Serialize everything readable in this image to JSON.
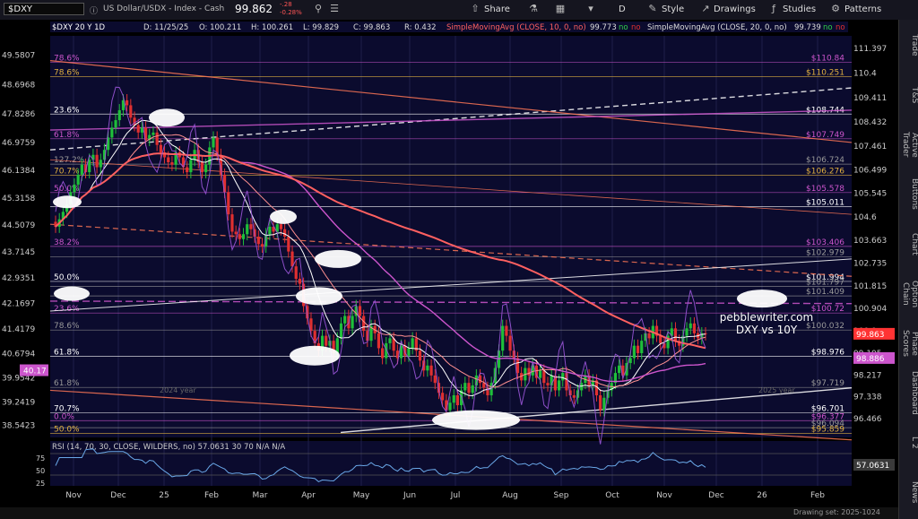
{
  "toolbar": {
    "symbol": "$DXY",
    "description": "US Dollar/USDX - Index - Cash",
    "last": "99.862",
    "change": "-.28",
    "change_pct": "-0.28%",
    "share": "Share",
    "interval": "D",
    "style": "Style",
    "drawings": "Drawings",
    "studies": "Studies",
    "patterns": "Patterns"
  },
  "side_tabs": [
    "Trade",
    "T&S",
    "Active Trader",
    "Buttons",
    "Chart",
    "Option Chain",
    "Phase Scores",
    "Dashboard",
    "L 2",
    "News"
  ],
  "status": {
    "drawing_set": "Drawing set: 2025-1024"
  },
  "chart_data": {
    "type": "candlestick",
    "header": {
      "symbol_line": "$DXY 20 Y 1D",
      "date": "D: 11/25/25",
      "open": "O: 100.211",
      "high": "H: 100.261",
      "low": "L: 99.829",
      "close": "C: 99.863",
      "range": "R: 0.432",
      "sma10": "SimpleMovingAvg (CLOSE, 10, 0, no)",
      "sma10_val": "99.773",
      "sma20": "SimpleMovingAvg (CLOSE, 20, 0, no)",
      "sma20_val": "99.739",
      "no": "no"
    },
    "watermark": "pebblewriter.com",
    "subtitle": "DXY vs 10Y",
    "ylim": [
      95.7,
      111.9
    ],
    "right_ticks": [
      "111.397",
      "110.4",
      "109.411",
      "108.432",
      "107.461",
      "106.499",
      "105.545",
      "104.6",
      "103.663",
      "102.735",
      "101.815",
      "100.904",
      "100.0",
      "99.105",
      "98.217",
      "97.338",
      "96.466"
    ],
    "left_ticks": [
      "49.5807",
      "48.6968",
      "47.8286",
      "46.9759",
      "46.1384",
      "45.3158",
      "44.5079",
      "43.7145",
      "42.9351",
      "42.1697",
      "41.4179",
      "40.6794",
      "39.9542",
      "39.2419",
      "38.5423"
    ],
    "left_ylim": [
      38.18,
      50.15
    ],
    "x_ticks": [
      "Nov",
      "Dec",
      "25",
      "Feb",
      "Mar",
      "Apr",
      "May",
      "Jun",
      "Jul",
      "Aug",
      "Sep",
      "Oct",
      "Nov",
      "Dec",
      "26",
      "Feb"
    ],
    "fib_labels_right": [
      {
        "v": 110.84,
        "t": "$110.84",
        "c": "#cc55cc"
      },
      {
        "v": 110.251,
        "t": "$110.251",
        "c": "#e0b040"
      },
      {
        "v": 108.744,
        "t": "$108.744",
        "c": "#ffffff"
      },
      {
        "v": 107.749,
        "t": "$107.749",
        "c": "#cc55cc"
      },
      {
        "v": 106.724,
        "t": "$106.724",
        "c": "#999999"
      },
      {
        "v": 106.276,
        "t": "$106.276",
        "c": "#e0b040"
      },
      {
        "v": 105.578,
        "t": "$105.578",
        "c": "#cc55cc"
      },
      {
        "v": 105.011,
        "t": "$105.011",
        "c": "#ffffff"
      },
      {
        "v": 103.406,
        "t": "$103.406",
        "c": "#cc55cc"
      },
      {
        "v": 102.979,
        "t": "$102.979",
        "c": "#999999"
      },
      {
        "v": 101.994,
        "t": "$101.994",
        "c": "#ffffff"
      },
      {
        "v": 101.797,
        "t": "$101.797",
        "c": "#999999"
      },
      {
        "v": 101.409,
        "t": "$101.409",
        "c": "#999999"
      },
      {
        "v": 100.72,
        "t": "$100.72",
        "c": "#cc55cc"
      },
      {
        "v": 100.032,
        "t": "$100.032",
        "c": "#999999"
      },
      {
        "v": 98.976,
        "t": "$98.976",
        "c": "#ffffff"
      },
      {
        "v": 97.719,
        "t": "$97.719",
        "c": "#999999"
      },
      {
        "v": 96.701,
        "t": "$96.701",
        "c": "#ffffff"
      },
      {
        "v": 96.377,
        "t": "$96.377",
        "c": "#cc55cc"
      },
      {
        "v": 96.094,
        "t": "$96.094",
        "c": "#999999"
      },
      {
        "v": 95.859,
        "t": "$95.859",
        "c": "#e0b040"
      }
    ],
    "fib_labels_left": [
      {
        "v": 110.84,
        "t": "78.6%",
        "c": "#cc55cc"
      },
      {
        "v": 110.251,
        "t": "78.6%",
        "c": "#e0b040"
      },
      {
        "v": 108.744,
        "t": "23.6%",
        "c": "#ffffff"
      },
      {
        "v": 107.749,
        "t": "61.8%",
        "c": "#cc55cc"
      },
      {
        "v": 106.724,
        "t": "127.2%",
        "c": "#999999"
      },
      {
        "v": 106.276,
        "t": "70.7%",
        "c": "#e0b040"
      },
      {
        "v": 105.578,
        "t": "50.0%",
        "c": "#cc55cc"
      },
      {
        "v": 103.406,
        "t": "38.2%",
        "c": "#cc55cc"
      },
      {
        "v": 101.994,
        "t": "50.0%",
        "c": "#ffffff"
      },
      {
        "v": 100.72,
        "t": "23.6%",
        "c": "#cc55cc"
      },
      {
        "v": 100.032,
        "t": "78.6%",
        "c": "#999999"
      },
      {
        "v": 98.976,
        "t": "61.8%",
        "c": "#ffffff"
      },
      {
        "v": 97.719,
        "t": "61.8%",
        "c": "#999999"
      },
      {
        "v": 96.701,
        "t": "70.7%",
        "c": "#ffffff"
      },
      {
        "v": 96.377,
        "t": "0.0%",
        "c": "#cc55cc"
      },
      {
        "v": 95.859,
        "t": "50.0%",
        "c": "#e0b040"
      }
    ],
    "price_tags": [
      {
        "v": 99.863,
        "t": "99.863",
        "c": "#ff3333"
      },
      {
        "v": 98.886,
        "t": "98.886",
        "c": "#cc55cc"
      }
    ],
    "left_tag": {
      "v": 40.17,
      "t": "40.17",
      "c": "#cc55cc"
    },
    "closes": [
      104.2,
      104.5,
      104.8,
      105.1,
      105.6,
      105.9,
      106.3,
      106.7,
      106.4,
      106.9,
      107.1,
      106.6,
      106.9,
      107.3,
      107.8,
      108.2,
      108.5,
      108.9,
      109.3,
      109.1,
      108.6,
      108.3,
      108.0,
      108.2,
      107.7,
      107.9,
      108.0,
      107.5,
      107.2,
      107.0,
      106.8,
      106.7,
      107.2,
      107.0,
      106.6,
      106.4,
      106.9,
      107.3,
      106.8,
      106.4,
      106.7,
      107.4,
      107.8,
      107.1,
      106.3,
      105.6,
      104.7,
      104.0,
      103.9,
      103.7,
      103.9,
      104.3,
      104.1,
      103.8,
      103.5,
      103.4,
      103.9,
      104.2,
      104.0,
      104.3,
      104.1,
      103.8,
      103.2,
      102.6,
      102.1,
      101.9,
      101.0,
      100.5,
      100.0,
      99.5,
      99.2,
      99.8,
      99.4,
      99.6,
      99.1,
      99.7,
      100.3,
      100.6,
      100.1,
      100.6,
      101.0,
      100.6,
      100.0,
      99.6,
      100.2,
      99.9,
      99.3,
      98.9,
      99.5,
      99.7,
      99.2,
      98.9,
      99.4,
      99.0,
      99.3,
      99.7,
      99.2,
      98.8,
      98.4,
      98.6,
      98.2,
      97.9,
      97.5,
      97.2,
      96.8,
      97.1,
      97.4,
      97.0,
      97.6,
      97.9,
      97.5,
      97.8,
      98.2,
      97.9,
      97.7,
      97.4,
      97.9,
      98.5,
      99.2,
      100.2,
      99.8,
      99.2,
      98.9,
      98.3,
      98.0,
      98.5,
      98.2,
      98.6,
      98.1,
      98.4,
      97.9,
      97.8,
      98.2,
      97.6,
      98.0,
      98.3,
      97.6,
      97.4,
      97.3,
      97.6,
      97.9,
      98.2,
      97.8,
      98.0,
      97.4,
      96.8,
      97.3,
      97.6,
      97.9,
      98.3,
      98.6,
      98.2,
      98.7,
      98.9,
      99.4,
      99.1,
      99.6,
      99.9,
      99.7,
      100.2,
      99.8,
      99.5,
      99.3,
      99.8,
      100.1,
      99.6,
      99.4,
      99.8,
      100.1,
      100.3,
      99.9,
      99.7,
      99.9,
      99.86
    ]
  }
}
